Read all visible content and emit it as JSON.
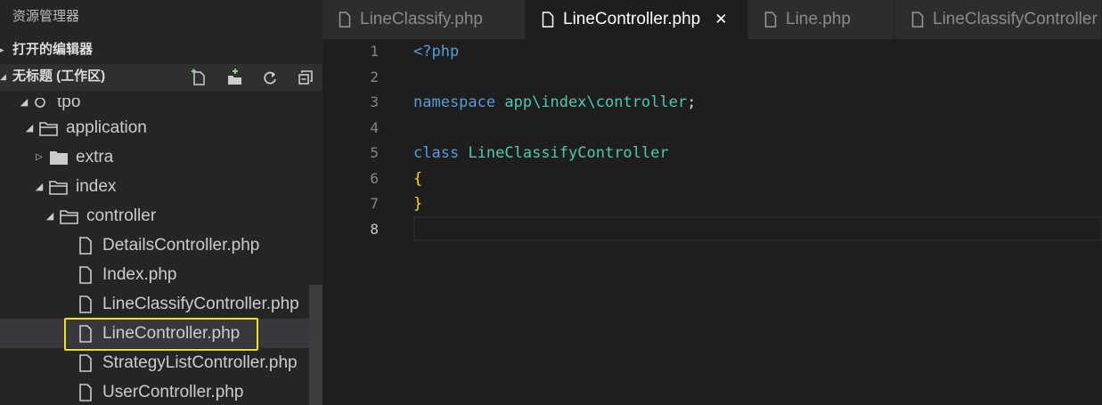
{
  "sidebar": {
    "title": "资源管理器",
    "open_editors_label": "打开的编辑器",
    "workspace_label": "无标题 (工作区)",
    "tree": {
      "root_partial": "tpo",
      "items": [
        {
          "label": "application",
          "kind": "folder-open"
        },
        {
          "label": "extra",
          "kind": "folder-closed"
        },
        {
          "label": "index",
          "kind": "folder-open"
        },
        {
          "label": "controller",
          "kind": "folder-open"
        },
        {
          "label": "DetailsController.php",
          "kind": "file"
        },
        {
          "label": "Index.php",
          "kind": "file"
        },
        {
          "label": "LineClassifyController.php",
          "kind": "file"
        },
        {
          "label": "LineController.php",
          "kind": "file",
          "selected": true
        },
        {
          "label": "StrategyListController.php",
          "kind": "file"
        },
        {
          "label": "UserController.php",
          "kind": "file"
        }
      ]
    },
    "actions": [
      "new-file-icon",
      "new-folder-icon",
      "refresh-icon",
      "collapse-all-icon"
    ]
  },
  "tabs": [
    {
      "label": "LineClassify.php",
      "active": false
    },
    {
      "label": "LineController.php",
      "active": true,
      "close": "✕"
    },
    {
      "label": "Line.php",
      "active": false
    },
    {
      "label": "LineClassifyController",
      "active": false
    }
  ],
  "editor": {
    "line_numbers": [
      "1",
      "2",
      "3",
      "4",
      "5",
      "6",
      "7",
      "8"
    ],
    "current_line": 8,
    "code": {
      "l1": "<?php",
      "l3_kw": "namespace",
      "l3_ns": "app\\index\\controller",
      "l3_end": ";",
      "l5_kw": "class",
      "l5_name": "LineClassifyController",
      "l6": "{",
      "l7": "}"
    }
  },
  "colors": {
    "highlight_box": "#f2e216",
    "keyword": "#569cd6",
    "type": "#4ec9b0",
    "brace": "#ffd700"
  }
}
